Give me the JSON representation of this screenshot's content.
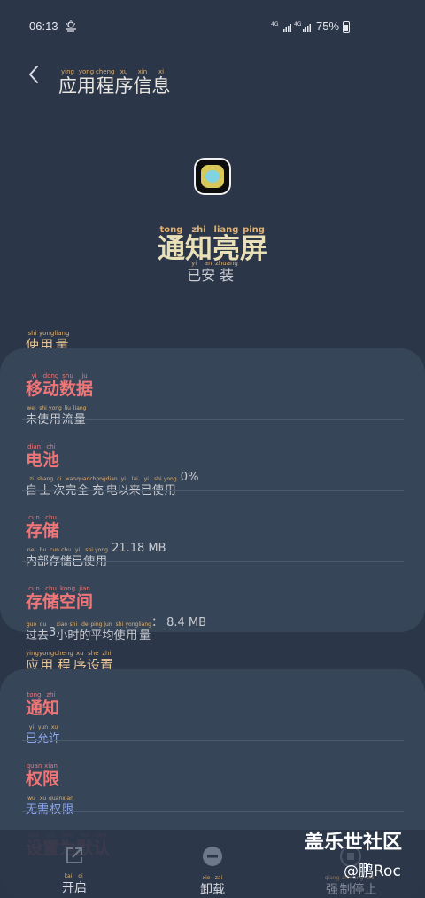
{
  "status_bar": {
    "time": "06:13",
    "weather_icon": "cloud-sun-icon",
    "network": "4G 4G",
    "battery_percent": "75%"
  },
  "header": {
    "back_icon": "chevron-left-icon",
    "title_pinyin": [
      "ying",
      "yong",
      "cheng",
      "xu",
      "xin",
      "xi"
    ],
    "title_chars": [
      "应",
      "用",
      "程",
      "序",
      "信",
      "息"
    ]
  },
  "app": {
    "icon": "app-notification-icon",
    "name_pinyin": [
      "tong",
      "zhi",
      "liang",
      "ping"
    ],
    "name_chars": [
      "通",
      "知",
      "亮",
      "屏"
    ],
    "status_pinyin": [
      "yi",
      "an",
      "zhuang"
    ],
    "status_chars": [
      "已",
      "安",
      "装"
    ]
  },
  "usage_section": {
    "title_pinyin": [
      "shi",
      "yong",
      "liang"
    ],
    "title_chars": [
      "使",
      "用",
      "量"
    ],
    "rows": [
      {
        "title_pinyin": [
          "yi",
          "dong",
          "shu",
          "ju"
        ],
        "title_chars": [
          "移",
          "动",
          "数",
          "据"
        ],
        "sub_pinyin": [
          "wei",
          "shi",
          "yong",
          "liu",
          "liang"
        ],
        "sub_chars": [
          "未",
          "使",
          "用",
          "流",
          "量"
        ],
        "sub_suffix": ""
      },
      {
        "title_pinyin": [
          "dian",
          "chi"
        ],
        "title_chars": [
          "电",
          "池"
        ],
        "sub_pinyin": [
          "zi",
          "shang",
          "ci",
          "wan",
          "quan",
          "chong",
          "dian",
          "yi",
          "lai",
          "yi",
          "shi",
          "yong"
        ],
        "sub_chars": [
          "自",
          "上",
          "次",
          "完",
          "全",
          "充",
          "电",
          "以",
          "来",
          "已",
          "使",
          "用"
        ],
        "sub_suffix": " 0%"
      },
      {
        "title_pinyin": [
          "cun",
          "chu"
        ],
        "title_chars": [
          "存",
          "储"
        ],
        "sub_pinyin": [
          "nei",
          "bu",
          "cun",
          "chu",
          "yi",
          "shi",
          "yong"
        ],
        "sub_chars": [
          "内",
          "部",
          "存",
          "储",
          "已",
          "使",
          "用"
        ],
        "sub_suffix": " 21.18 MB"
      },
      {
        "title_pinyin": [
          "cun",
          "chu",
          "kong",
          "jian"
        ],
        "title_chars": [
          "存",
          "储",
          "空",
          "间"
        ],
        "sub_pinyin": [
          "guo",
          "qu",
          "",
          "xiao",
          "shi",
          "de",
          "ping",
          "jun",
          "shi",
          "yong",
          "liang"
        ],
        "sub_chars": [
          "过",
          "去",
          " 3 ",
          "小",
          "时",
          "的",
          "平",
          "均",
          "使",
          "用",
          "量"
        ],
        "sub_suffix": "： 8.4 MB"
      }
    ]
  },
  "settings_section": {
    "title_pinyin": [
      "ying",
      "yong",
      "cheng",
      "xu",
      "she",
      "zhi"
    ],
    "title_chars": [
      "应",
      "用",
      "程",
      "序",
      "设",
      "置"
    ],
    "rows": [
      {
        "title_pinyin": [
          "tong",
          "zhi"
        ],
        "title_chars": [
          "通",
          "知"
        ],
        "sub_pinyin": [
          "yi",
          "yun",
          "xu"
        ],
        "sub_chars": [
          "已",
          "允",
          "许"
        ]
      },
      {
        "title_pinyin": [
          "quan",
          "xian"
        ],
        "title_chars": [
          "权",
          "限"
        ],
        "sub_pinyin": [
          "wu",
          "xu",
          "quan",
          "xian"
        ],
        "sub_chars": [
          "无",
          "需",
          "权",
          "限"
        ]
      },
      {
        "title_pinyin": [
          "she",
          "zhi",
          "wei",
          "mo",
          "ren"
        ],
        "title_chars": [
          "设",
          "置",
          "为",
          "默",
          "认"
        ],
        "sub_pinyin": [],
        "sub_chars": []
      }
    ]
  },
  "bottom_bar": {
    "open": {
      "icon": "open-external-icon",
      "pinyin": [
        "kai",
        "qi"
      ],
      "chars": [
        "开",
        "启"
      ]
    },
    "uninstall": {
      "icon": "minus-circle-icon",
      "pinyin": [
        "xie",
        "zai"
      ],
      "chars": [
        "卸",
        "载"
      ]
    },
    "force_stop": {
      "icon": "stop-icon",
      "pinyin": [
        "qiang",
        "zhi",
        "ting",
        "zhi"
      ],
      "chars": [
        "强",
        "制",
        "停",
        "止"
      ]
    }
  },
  "watermark": {
    "line1": "盖乐世社区",
    "line2": "@鹏Roc"
  },
  "colors": {
    "background": "#2b3649",
    "card": "#364558",
    "accent_title": "#ef7577",
    "section_title": "#e8c597",
    "subtitle_blue": "#8ea8f2"
  }
}
